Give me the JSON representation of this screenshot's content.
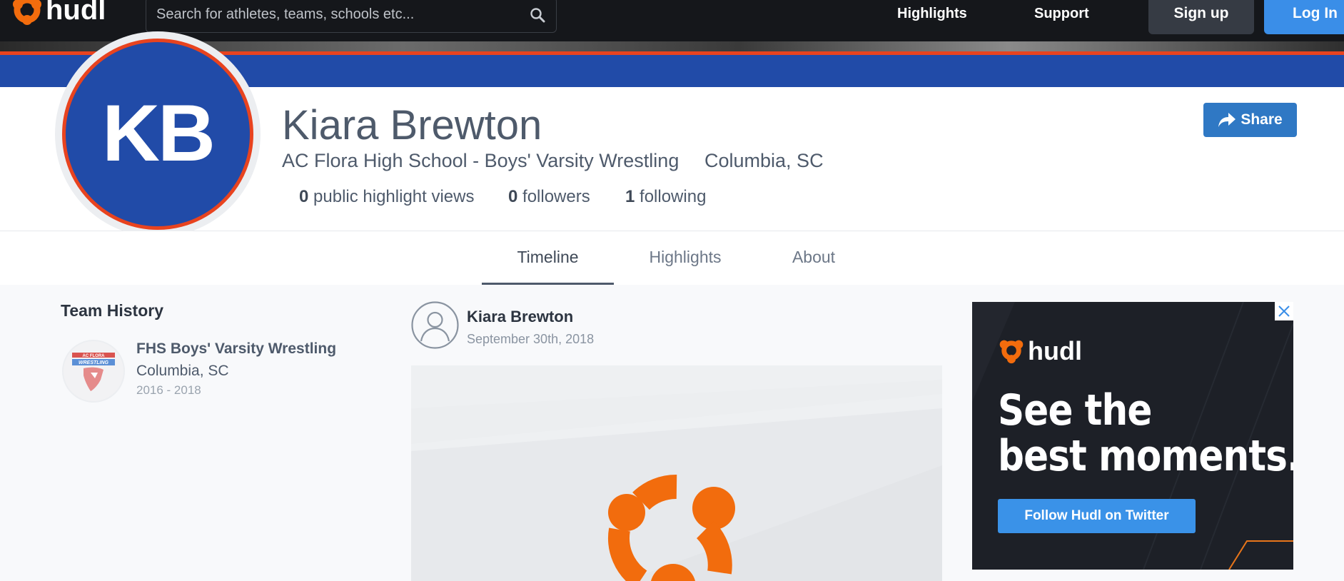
{
  "nav": {
    "brand": "hudl",
    "search_placeholder": "Search for athletes, teams, schools etc...",
    "links": [
      "Highlights",
      "Support"
    ],
    "signup_label": "Sign up",
    "login_label": "Log In"
  },
  "colors": {
    "nav_bg": "#15171b",
    "brand_orange": "#f26c0d",
    "profile_blue": "#214ba8",
    "accent_red": "#e8431f",
    "link_blue": "#3a8ee8"
  },
  "profile": {
    "initials": "KB",
    "name": "Kiara Brewton",
    "team_line": "AC Flora High School - Boys' Varsity Wrestling",
    "location": "Columbia, SC",
    "stats": [
      {
        "count": "0",
        "label": "public highlight views"
      },
      {
        "count": "0",
        "label": "followers"
      },
      {
        "count": "1",
        "label": "following"
      }
    ],
    "share_label": "Share"
  },
  "tabs": [
    {
      "label": "Timeline",
      "active": true
    },
    {
      "label": "Highlights",
      "active": false
    },
    {
      "label": "About",
      "active": false
    }
  ],
  "team_history": {
    "title": "Team History",
    "teams": [
      {
        "name": "FHS Boys' Varsity Wrestling",
        "location": "Columbia, SC",
        "years": "2016 - 2018",
        "logo_text": "AC FLORA",
        "logo_banner": "WRESTLING"
      }
    ]
  },
  "post": {
    "author": "Kiara Brewton",
    "date": "September 30th, 2018"
  },
  "ad": {
    "brand": "hudl",
    "headline_line1": "See the",
    "headline_line2": "best moments.",
    "cta_label": "Follow Hudl on Twitter"
  }
}
